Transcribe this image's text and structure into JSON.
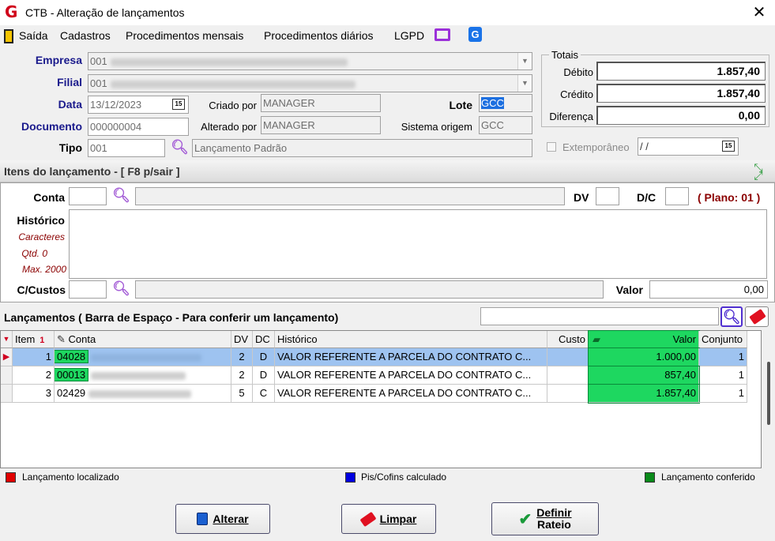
{
  "window": {
    "title": "CTB - Alteração de lançamentos",
    "close": "✕"
  },
  "menu": {
    "items": [
      "Saída",
      "Cadastros",
      "Procedimentos mensais",
      "Procedimentos diários",
      "LGPD"
    ]
  },
  "header": {
    "empresa_label": "Empresa",
    "empresa_code": "001",
    "filial_label": "Filial",
    "filial_code": "001",
    "data_label": "Data",
    "data_value": "13/12/2023",
    "documento_label": "Documento",
    "documento_value": "000000004",
    "tipo_label": "Tipo",
    "tipo_code": "001",
    "tipo_desc": "Lançamento Padrão",
    "criado_label": "Criado por",
    "criado_value": "MANAGER",
    "alterado_label": "Alterado por",
    "alterado_value": "MANAGER",
    "lote_label": "Lote",
    "lote_value": "GCC",
    "sistema_label": "Sistema origem",
    "sistema_value": "GCC",
    "calendar_glyph": "15"
  },
  "totais": {
    "title": "Totais",
    "debito_label": "Débito",
    "debito_value": "1.857,40",
    "credito_label": "Crédito",
    "credito_value": "1.857,40",
    "diferenca_label": "Diferença",
    "diferenca_value": "0,00",
    "extemporaneo_label": "Extemporâneo",
    "extemporaneo_value": " / /"
  },
  "itens": {
    "title": "Itens do lançamento - [ F8 p/sair ]",
    "conta_label": "Conta",
    "dv_label": "DV",
    "dc_label": "D/C",
    "plano_label": "( Plano: 01 )",
    "historico_label": "Histórico",
    "caracteres_label": "Caracteres",
    "qtd_label": "Qtd. 0",
    "max_label": "Max. 2000",
    "ccustos_label": "C/Custos",
    "valor_label": "Valor",
    "valor_value": "0,00"
  },
  "lancamentos": {
    "title": "Lançamentos ( Barra de Espaço - Para conferir um lançamento)",
    "columns": [
      "Item",
      "Conta",
      "DV",
      "DC",
      "Histórico",
      "Custo",
      "Valor",
      "Conjunto"
    ],
    "rows": [
      {
        "item": "1",
        "conta": "04028",
        "dv": "2",
        "dc": "D",
        "historico": "VALOR REFERENTE A PARCELA DO CONTRATO C...",
        "custo": "",
        "valor": "1.000,00",
        "conjunto": "1"
      },
      {
        "item": "2",
        "conta": "00013",
        "dv": "2",
        "dc": "D",
        "historico": "VALOR REFERENTE A PARCELA DO CONTRATO C...",
        "custo": "",
        "valor": "857,40",
        "conjunto": "1"
      },
      {
        "item": "3",
        "conta": "02429",
        "dv": "5",
        "dc": "C",
        "historico": "VALOR REFERENTE A PARCELA DO CONTRATO C...",
        "custo": "",
        "valor": "1.857,40",
        "conjunto": "1"
      }
    ]
  },
  "legend": {
    "localizado": "Lançamento localizado",
    "localizado_color": "#e00000",
    "pis": "Pis/Cofins calculado",
    "pis_color": "#0000e0",
    "conferido": "Lançamento conferido",
    "conferido_color": "#0a8a1a"
  },
  "buttons": {
    "alterar": "Alterar",
    "limpar": "Limpar",
    "definir_line1": "Definir",
    "definir_line2": "Rateio"
  }
}
